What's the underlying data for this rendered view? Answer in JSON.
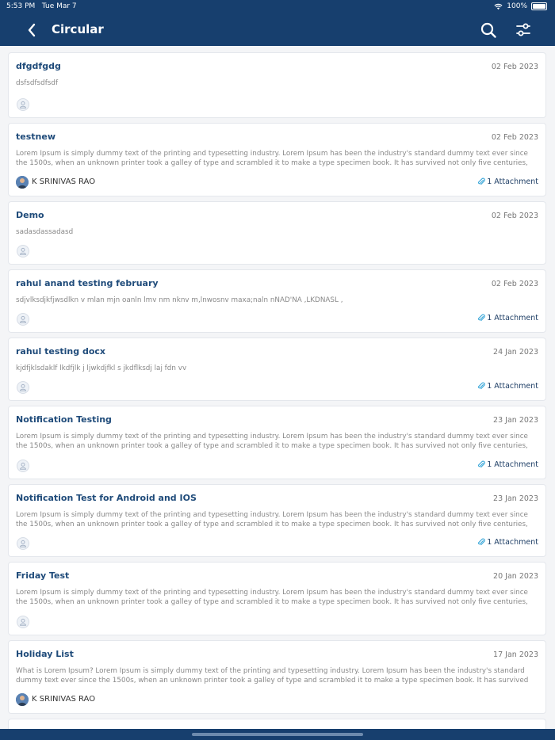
{
  "status": {
    "time": "5:53 PM",
    "date": "Tue Mar 7",
    "battery": "100%"
  },
  "nav": {
    "title": "Circular"
  },
  "circulars": [
    {
      "title": "dfgdfgdg",
      "date": "02 Feb 2023",
      "body": "dsfsdfsdfsdf",
      "author": "",
      "attachment": ""
    },
    {
      "title": "testnew",
      "date": "02 Feb 2023",
      "body": "Lorem Ipsum is simply dummy text of the printing and typesetting industry. Lorem Ipsum has been the industry's standard dummy text ever since the 1500s, when an unknown printer took a galley of type and scrambled it to make a type specimen book. It has survived not only five centuries, but also t...",
      "author": "K SRINIVAS RAO",
      "attachment": "1 Attachment"
    },
    {
      "title": "Demo",
      "date": "02 Feb 2023",
      "body": "sadasdassadasd",
      "author": "",
      "attachment": ""
    },
    {
      "title": "rahul anand testing february",
      "date": "02 Feb 2023",
      "body": "sdjvlksdjkfjwsdlkn v mlan mjn oanln lmv nm nknv m,lnwosnv maxa;naln  nNAD'NA ,LKDNASL ,",
      "author": "",
      "attachment": "1 Attachment"
    },
    {
      "title": "rahul testing docx",
      "date": "24 Jan 2023",
      "body": "kjdfjklsdaklf lkdfjlk j ljwkdjfkl s jkdflksdj laj fdn vv",
      "author": "",
      "attachment": "1 Attachment"
    },
    {
      "title": "Notification Testing",
      "date": "23 Jan 2023",
      "body": "Lorem Ipsum is simply dummy text of the printing and typesetting industry. Lorem Ipsum has been the industry's standard dummy text ever since the 1500s, when an unknown printer took a galley of type and scrambled it to make a type specimen book. It has survived not only five centuries, but also t...",
      "author": "",
      "attachment": "1 Attachment"
    },
    {
      "title": "Notification Test for Android and IOS",
      "date": "23 Jan 2023",
      "body": "Lorem Ipsum is simply dummy text of the printing and typesetting industry. Lorem Ipsum has been the industry's standard dummy text ever since the 1500s, when an unknown printer took a galley of type and scrambled it to make a type specimen book. It has survived not only five centuries, but also t...",
      "author": "",
      "attachment": "1 Attachment"
    },
    {
      "title": "Friday Test",
      "date": "20 Jan 2023",
      "body": "Lorem Ipsum is simply dummy text of the printing and typesetting industry. Lorem Ipsum has been the industry's standard dummy text ever since the 1500s, when an unknown printer took a galley of type and scrambled it to make a type specimen book. It has survived not only five centuries, but also t...",
      "author": "",
      "attachment": ""
    },
    {
      "title": "Holiday List",
      "date": "17 Jan 2023",
      "body": "What is Lorem Ipsum? Lorem Ipsum is simply dummy text of the printing and typesetting industry. Lorem Ipsum has been the industry's standard dummy text ever since the 1500s, when an unknown printer took a galley of type and scrambled it to make a type specimen book. It has survived not only five...",
      "author": "K SRINIVAS RAO",
      "attachment": ""
    }
  ],
  "icons": {
    "back": "chevron-left-icon",
    "search": "search-icon",
    "filter": "sliders-icon",
    "attachment": "paperclip-icon",
    "avatar": "user-icon"
  },
  "colors": {
    "header": "#173f6e",
    "title": "#1f4b7a"
  }
}
